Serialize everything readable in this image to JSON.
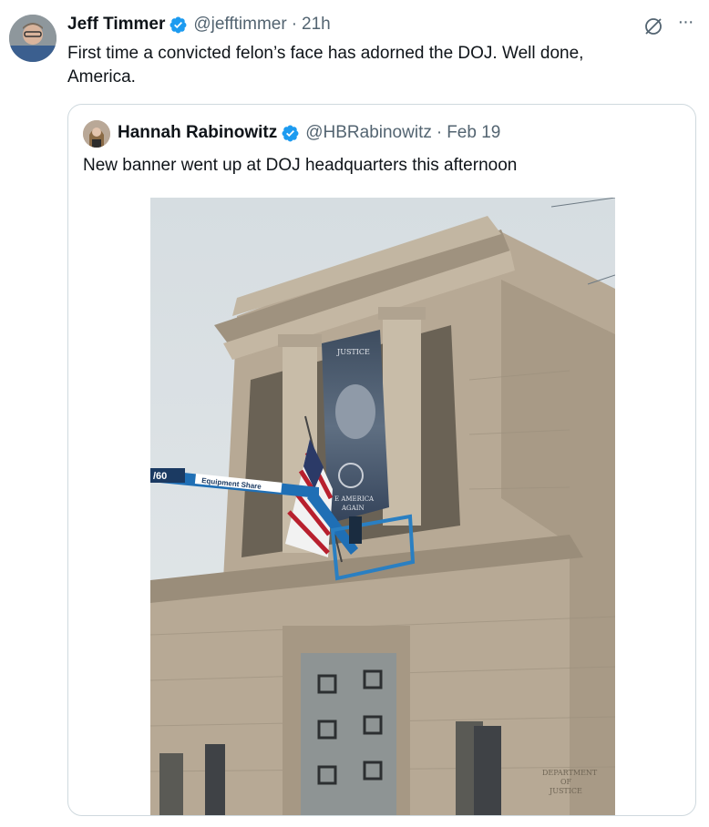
{
  "tweet": {
    "author_name": "Jeff Timmer",
    "handle": "@jefftimmer",
    "separator": "·",
    "time": "21h",
    "text": "First time a convicted felon’s face has adorned the DOJ. Well done, America.",
    "more_label": "···"
  },
  "quoted_tweet": {
    "author_name": "Hannah Rabinowitz",
    "handle": "@HBRabinowitz",
    "separator": "·",
    "date": "Feb 19",
    "text": "New banner went up at DOJ headquarters this afternoon",
    "photo": {
      "banner_top_text": "JUSTICE",
      "banner_bottom_text_1": "E AMERICA",
      "banner_bottom_text_2": "AGAIN",
      "lift_label": "Equipment Share",
      "lift_number": "/60",
      "plaque_line1": "DEPARTMENT",
      "plaque_line2": "OF",
      "plaque_line3": "JUSTICE"
    }
  },
  "colors": {
    "verified_blue": "#1d9bf0",
    "text_primary": "#0f1419",
    "text_secondary": "#536471",
    "border": "#cfd9de"
  }
}
